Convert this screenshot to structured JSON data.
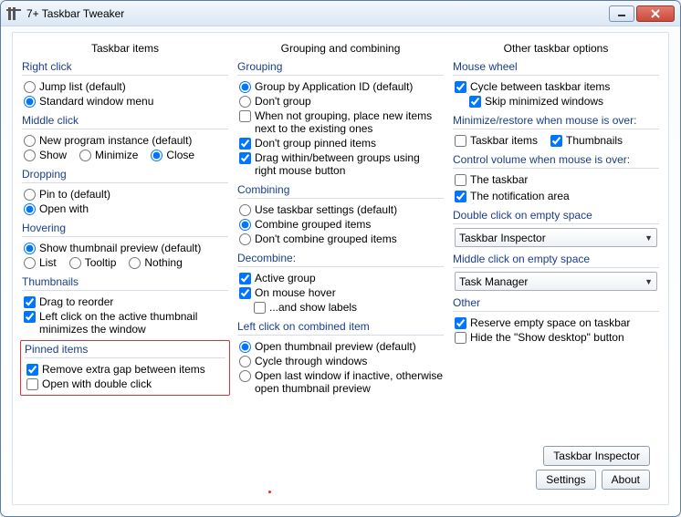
{
  "window": {
    "title": "7+ Taskbar Tweaker"
  },
  "columns": {
    "col1": {
      "title": "Taskbar items",
      "rightClick": {
        "title": "Right click",
        "jumpList": "Jump list (default)",
        "stdMenu": "Standard window menu"
      },
      "middleClick": {
        "title": "Middle click",
        "newProgram": "New program instance (default)",
        "show": "Show",
        "minimize": "Minimize",
        "close": "Close"
      },
      "dropping": {
        "title": "Dropping",
        "pinTo": "Pin to (default)",
        "openWith": "Open with"
      },
      "hovering": {
        "title": "Hovering",
        "thumb": "Show thumbnail preview (default)",
        "list": "List",
        "tooltip": "Tooltip",
        "nothing": "Nothing"
      },
      "thumbnails": {
        "title": "Thumbnails",
        "dragReorder": "Drag to reorder",
        "leftClickMin": "Left click on the active thumbnail minimizes the window"
      },
      "pinned": {
        "title": "Pinned items",
        "removeGap": "Remove extra gap between items",
        "openDbl": "Open with double click"
      }
    },
    "col2": {
      "title": "Grouping and combining",
      "grouping": {
        "title": "Grouping",
        "byAppId": "Group by Application ID (default)",
        "dontGroup": "Don't group",
        "placeNew": "When not grouping, place new items next to the existing ones",
        "dontGroupPinned": "Don't group pinned items",
        "dragWithin": "Drag within/between groups using right mouse button"
      },
      "combining": {
        "title": "Combining",
        "useTaskbar": "Use taskbar settings (default)",
        "combine": "Combine grouped items",
        "dontCombine": "Don't combine grouped items"
      },
      "decombine": {
        "title": "Decombine:",
        "active": "Active group",
        "hover": "On mouse hover",
        "labels": "...and show labels"
      },
      "leftClick": {
        "title": "Left click on combined item",
        "openThumb": "Open thumbnail preview (default)",
        "cycle": "Cycle through windows",
        "openLast": "Open last window if inactive, otherwise open thumbnail preview"
      }
    },
    "col3": {
      "title": "Other taskbar options",
      "mouseWheel": {
        "title": "Mouse wheel",
        "cycle": "Cycle between taskbar items",
        "skip": "Skip minimized windows"
      },
      "minRestore": {
        "title": "Minimize/restore when mouse is over:",
        "taskbarItems": "Taskbar items",
        "thumbnails": "Thumbnails"
      },
      "volume": {
        "title": "Control volume when mouse is over:",
        "taskbar": "The taskbar",
        "notif": "The notification area"
      },
      "dblClick": {
        "title": "Double click on empty space",
        "value": "Taskbar Inspector"
      },
      "midClick": {
        "title": "Middle click on empty space",
        "value": "Task Manager"
      },
      "other": {
        "title": "Other",
        "reserve": "Reserve empty space on taskbar",
        "hideShow": "Hide the \"Show desktop\" button"
      },
      "buttons": {
        "inspector": "Taskbar Inspector",
        "settings": "Settings",
        "about": "About"
      }
    }
  }
}
